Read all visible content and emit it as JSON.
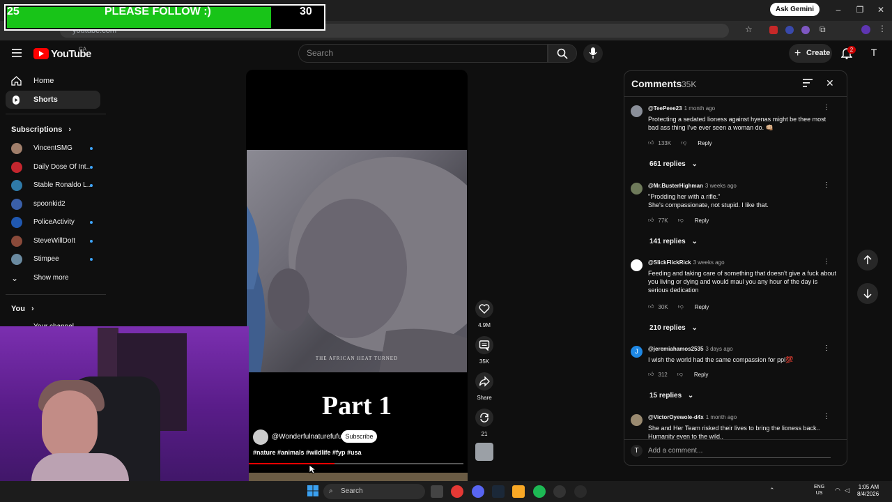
{
  "stream_overlay": {
    "start": "25",
    "message": "PLEASE FOLLOW :)",
    "end": "30",
    "progress_fraction": 0.83
  },
  "browser": {
    "ask_gemini": "Ask Gemini",
    "url": "youtube.com"
  },
  "header": {
    "logo_text": "YouTube",
    "country": "CA",
    "search_placeholder": "Search",
    "create_label": "Create",
    "notification_count": "2",
    "avatar_initial": "T"
  },
  "sidebar": {
    "nav": [
      {
        "label": "Home",
        "icon": "home-icon"
      },
      {
        "label": "Shorts",
        "icon": "shorts-icon"
      }
    ],
    "subscriptions_label": "Subscriptions",
    "subscriptions": [
      {
        "name": "VincentSMG",
        "color": "#a07e6a"
      },
      {
        "name": "Daily Dose Of Int...",
        "color": "#c4262e"
      },
      {
        "name": "Stable Ronaldo L...",
        "color": "#2f7aa8"
      },
      {
        "name": "spoonkid2",
        "color": "#3a5fa8"
      },
      {
        "name": "PoliceActivity",
        "color": "#2058b0"
      },
      {
        "name": "SteveWillDoIt",
        "color": "#8a4a3a"
      },
      {
        "name": "Stimpee",
        "color": "#6a8aa0"
      }
    ],
    "show_more": "Show more",
    "you_label": "You",
    "your_channel": "Your channel"
  },
  "video": {
    "caption": "THE AFRICAN HEAT TURNED",
    "title_overlay": "Part 1",
    "channel": "@Wonderfulnaturefufu",
    "subscribe": "Subscribe",
    "hashtags": "#nature #animals #wildlife #fyp #usa",
    "progress_fraction": 0.4
  },
  "actions": {
    "likes": "4.9M",
    "comments": "35K",
    "share": "Share",
    "remix": "21"
  },
  "comments": {
    "title": "Comments",
    "count": "35K",
    "add_placeholder": "Add a comment...",
    "items": [
      {
        "user": "@TeePeee23",
        "time": "1 month ago",
        "text": "Protecting a sedated lioness against hyenas might be thee most bad ass thing I’ve ever seen a woman do. 👊🏼",
        "likes": "133K",
        "reply": "Reply",
        "replies": "661 replies",
        "avatar": "#8a8f99"
      },
      {
        "user": "@Mr.BusterHighman",
        "time": "3 weeks ago",
        "text": "\"Prodding her with a rifle.\"\nShe's compassionate, not stupid. I like that.",
        "likes": "77K",
        "reply": "Reply",
        "replies": "141 replies",
        "avatar": "#6e7a5a"
      },
      {
        "user": "@SlickFlickRick",
        "time": "3 weeks ago",
        "text": "Feeding and taking care of something that doesn't give a fuck about you living or dying and would maul you any hour of the day is serious dedication",
        "likes": "30K",
        "reply": "Reply",
        "replies": "210 replies",
        "avatar": "#ffffff"
      },
      {
        "user": "@jeremiahamos2535",
        "time": "3 days ago",
        "text": "I wish the world had the same compassion for ppl💯",
        "likes": "312",
        "reply": "Reply",
        "replies": "15 replies",
        "avatar": "#1e88e5",
        "initial": "J"
      },
      {
        "user": "@VictorOyewole-d4x",
        "time": "1 month ago",
        "text": "She and Her Team risked their lives to bring the lioness back.. Humanity even to the wild..",
        "avatar": "#9a8a70"
      }
    ]
  },
  "taskbar": {
    "search": "Search",
    "lang_top": "ENG",
    "lang_bottom": "US",
    "time": "1:05 AM",
    "date": "8/4/2026"
  }
}
